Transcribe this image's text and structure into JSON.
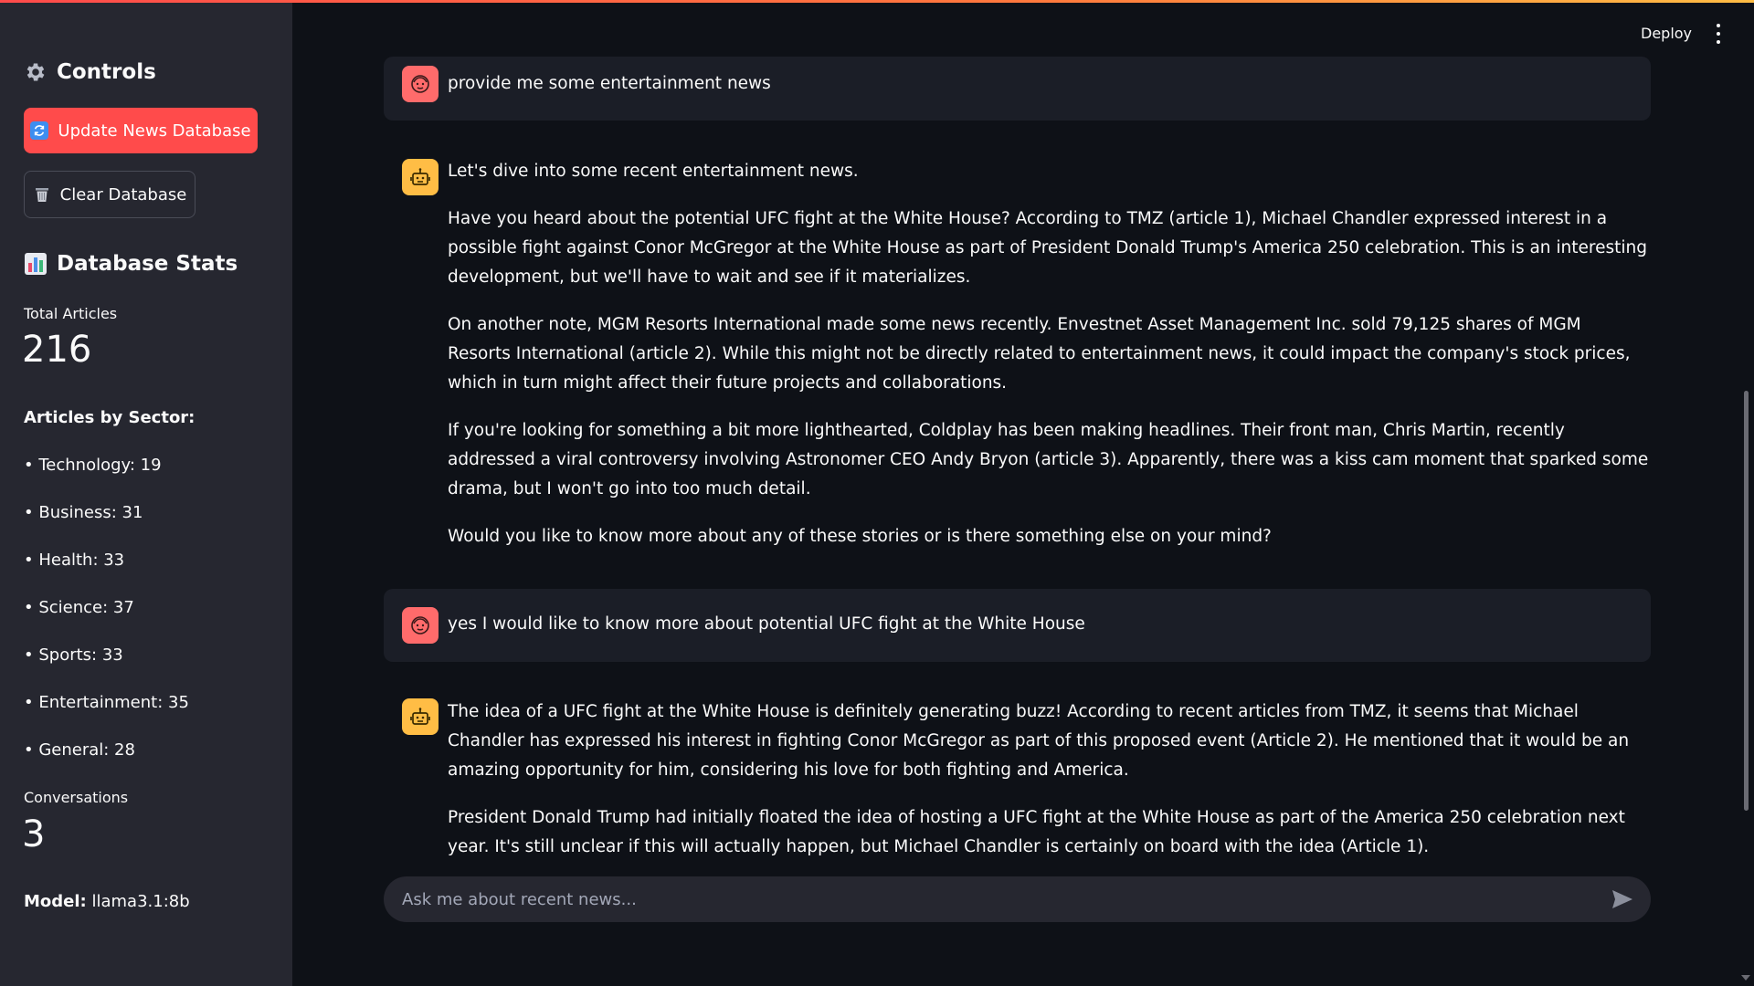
{
  "header": {
    "deploy_label": "Deploy",
    "menu_icon": "kebab-menu-icon"
  },
  "sidebar": {
    "controls_title": "Controls",
    "controls_icon": "gear-icon",
    "update_button": "Update News Database",
    "update_icon": "refresh-icon",
    "clear_button": "Clear Database",
    "clear_icon": "wastebasket-icon",
    "stats_title": "Database Stats",
    "stats_icon": "bar-chart-icon",
    "total_articles_label": "Total Articles",
    "total_articles_value": "216",
    "sector_title": "Articles by Sector:",
    "sectors": [
      "• Technology: 19",
      "• Business: 31",
      "• Health: 33",
      "• Science: 37",
      "• Sports: 33",
      "• Entertainment: 35",
      "• General: 28"
    ],
    "conversations_label": "Conversations",
    "conversations_value": "3",
    "model_label": "Model:",
    "model_value": "llama3.1:8b"
  },
  "chat": {
    "messages": [
      {
        "role": "user",
        "avatar": "user-face-icon",
        "paragraphs": [
          "provide me some entertainment news"
        ]
      },
      {
        "role": "assistant",
        "avatar": "robot-icon",
        "paragraphs": [
          "Let's dive into some recent entertainment news.",
          "Have you heard about the potential UFC fight at the White House? According to TMZ (article 1), Michael Chandler expressed interest in a possible fight against Conor McGregor at the White House as part of President Donald Trump's America 250 celebration. This is an interesting development, but we'll have to wait and see if it materializes.",
          "On another note, MGM Resorts International made some news recently. Envestnet Asset Management Inc. sold 79,125 shares of MGM Resorts International (article 2). While this might not be directly related to entertainment news, it could impact the company's stock prices, which in turn might affect their future projects and collaborations.",
          "If you're looking for something a bit more lighthearted, Coldplay has been making headlines. Their front man, Chris Martin, recently addressed a viral controversy involving Astronomer CEO Andy Bryon (article 3). Apparently, there was a kiss cam moment that sparked some drama, but I won't go into too much detail.",
          "Would you like to know more about any of these stories or is there something else on your mind?"
        ]
      },
      {
        "role": "user",
        "avatar": "user-face-icon",
        "paragraphs": [
          "yes I would like to know more about potential UFC fight at the White House"
        ]
      },
      {
        "role": "assistant",
        "avatar": "robot-icon",
        "paragraphs": [
          "The idea of a UFC fight at the White House is definitely generating buzz! According to recent articles from TMZ, it seems that Michael Chandler has expressed his interest in fighting Conor McGregor as part of this proposed event (Article 2). He mentioned that it would be an amazing opportunity for him, considering his love for both fighting and America.",
          "President Donald Trump had initially floated the idea of hosting a UFC fight at the White House as part of the America 250 celebration next year. It's still unclear if this will actually happen, but Michael Chandler is certainly on board with the idea (Article 1)."
        ]
      }
    ],
    "input_placeholder": "Ask me about recent news...",
    "send_icon": "send-icon"
  },
  "colors": {
    "accent": "#ff4b4b",
    "sidebar_bg": "#262730",
    "main_bg": "#0e1117",
    "user_avatar": "#ff6b6b",
    "bot_avatar": "#ffbd45"
  }
}
